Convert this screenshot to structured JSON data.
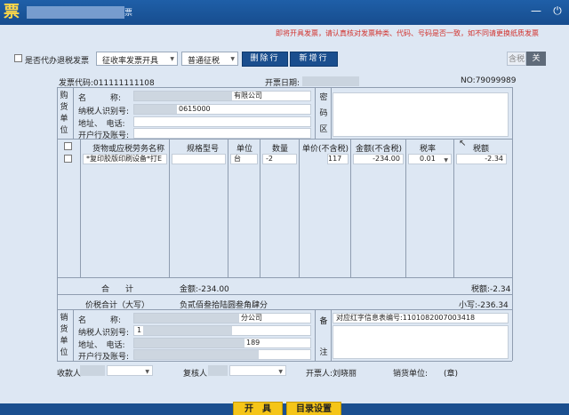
{
  "window": {
    "icon_glyph": "票",
    "title_tail": "票",
    "minimize_glyph": "—",
    "close_glyph": "⏻"
  },
  "notice": "即将开具发票，请认真核对发票种类、代码、号码是否一致，如不同请更换纸质发票",
  "toolbar": {
    "agent_refund_label": "是否代办退税发票",
    "invoice_type_value": "征收率发票开具",
    "tax_type_value": "普通征税",
    "delete_row_label": "删除行",
    "add_row_label": "新增行",
    "tax_included_label": "含税",
    "close_label": "关"
  },
  "header": {
    "invoice_code": "发票代码:011111111108",
    "invoice_date_label": "开票日期:",
    "invoice_no": "NO:79099989"
  },
  "buyer": {
    "side_chars": [
      "购",
      "货",
      "单",
      "位"
    ],
    "name_label": "名　　　称:",
    "name_value": "有限公司",
    "taxid_label": "纳税人识别号:",
    "taxid_value": "0615000",
    "addr_label": "地址、　电话:",
    "bank_label": "开户行及账号:",
    "cipher_chars": [
      "密",
      "码",
      "区"
    ]
  },
  "items": {
    "columns": [
      "货物或应税劳务名称",
      "规格型号",
      "单位",
      "数量",
      "单价(不含税)",
      "金额(不含税)",
      "税率",
      "税额"
    ],
    "rows": [
      {
        "name": "*复印胶版印刷设备*打E",
        "spec": "",
        "unit": "台",
        "qty": "-2",
        "price": "117",
        "amount": "-234.00",
        "rate": "0.01",
        "tax": "-2.34"
      }
    ]
  },
  "totals": {
    "total_label": "合　　计",
    "amount_total": "金额:-234.00",
    "tax_total": "税额:-2.34",
    "grand_label": "价税合计（大写）",
    "grand_words": "负贰佰叁拾陆圆叁角肆分",
    "grand_small": "小写:-236.34"
  },
  "seller": {
    "side_chars": [
      "销",
      "货",
      "单",
      "位"
    ],
    "name_label": "名　　　称:",
    "name_value": "分公司",
    "taxid_label": "纳税人识别号:",
    "taxid_value": "1",
    "addr_label": "地址、　电话:",
    "addr_value": "189",
    "bank_label": "开户行及账号:",
    "remark_chars": [
      "备",
      "注"
    ],
    "remark_value": "对应红字信息表编号:1101082007003418"
  },
  "footer": {
    "payee_label": "收款人",
    "reviewer_label": "复核人",
    "drawer_label": "开票人:刘晓丽",
    "seller_unit_label": "销货单位:　　(章)"
  },
  "actions": {
    "issue_label": "开　具",
    "catalog_label": "目录设置"
  },
  "colors": {
    "accent_blue": "#1a4e8e",
    "notice_red": "#d2322d",
    "action_yellow": "#f5c518",
    "background": "#dde7f3"
  }
}
